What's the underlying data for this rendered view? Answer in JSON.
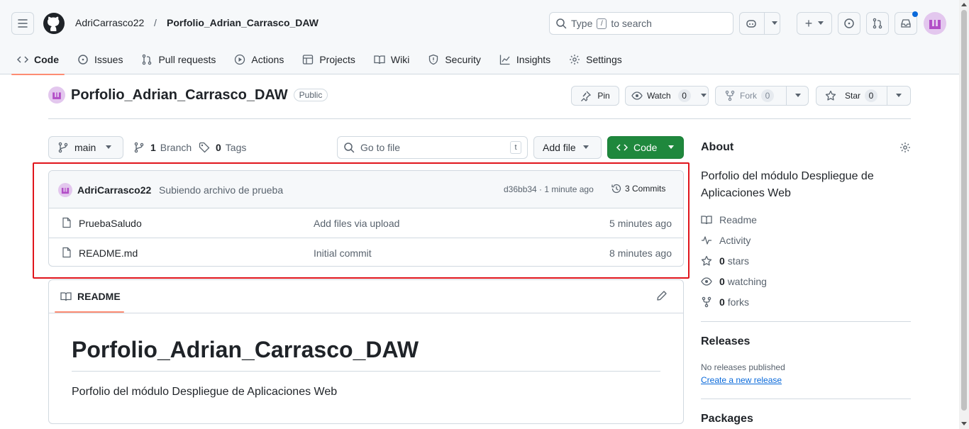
{
  "header": {
    "owner": "AdriCarrasco22",
    "separator": "/",
    "repo": "Porfolio_Adrian_Carrasco_DAW",
    "search_prefix": "Type",
    "search_key": "/",
    "search_suffix": "to search",
    "plus_label": "+"
  },
  "tabs": [
    {
      "label": "Code",
      "icon": "code-icon"
    },
    {
      "label": "Issues",
      "icon": "issue-icon"
    },
    {
      "label": "Pull requests",
      "icon": "pull-request-icon"
    },
    {
      "label": "Actions",
      "icon": "play-icon"
    },
    {
      "label": "Projects",
      "icon": "table-icon"
    },
    {
      "label": "Wiki",
      "icon": "book-icon"
    },
    {
      "label": "Security",
      "icon": "shield-icon"
    },
    {
      "label": "Insights",
      "icon": "graph-icon"
    },
    {
      "label": "Settings",
      "icon": "gear-icon"
    }
  ],
  "repo": {
    "name": "Porfolio_Adrian_Carrasco_DAW",
    "visibility": "Public",
    "pin_label": "Pin",
    "watch_label": "Watch",
    "watch_count": "0",
    "fork_label": "Fork",
    "fork_count": "0",
    "star_label": "Star",
    "star_count": "0"
  },
  "toolbar": {
    "branch": "main",
    "branch_count": "1",
    "branch_label": "Branch",
    "tag_count": "0",
    "tag_label": "Tags",
    "goto_placeholder": "Go to file",
    "goto_key": "t",
    "add_file_label": "Add file",
    "code_label": "Code"
  },
  "commit": {
    "author": "AdriCarrasco22",
    "message": "Subiendo archivo de prueba",
    "hash_time": "d36bb34 · 1 minute ago",
    "commits_label": "3 Commits"
  },
  "files": [
    {
      "name": "PruebaSaludo",
      "message": "Add files via upload",
      "time": "5 minutes ago"
    },
    {
      "name": "README.md",
      "message": "Initial commit",
      "time": "8 minutes ago"
    }
  ],
  "readme": {
    "tab_label": "README",
    "heading": "Porfolio_Adrian_Carrasco_DAW",
    "body": "Porfolio del módulo Despliegue de Aplicaciones Web"
  },
  "about": {
    "title": "About",
    "description": "Porfolio del módulo Despliegue de Aplicaciones Web",
    "readme_label": "Readme",
    "activity_label": "Activity",
    "stars_count": "0",
    "stars_label": "stars",
    "watching_count": "0",
    "watching_label": "watching",
    "forks_count": "0",
    "forks_label": "forks"
  },
  "releases": {
    "title": "Releases",
    "empty": "No releases published",
    "create_link": "Create a new release"
  },
  "packages": {
    "title": "Packages"
  },
  "colors": {
    "accent_green": "#1f883d",
    "link_blue": "#0969da",
    "tab_underline": "#fd8c73",
    "highlight_red": "#e0151c"
  }
}
